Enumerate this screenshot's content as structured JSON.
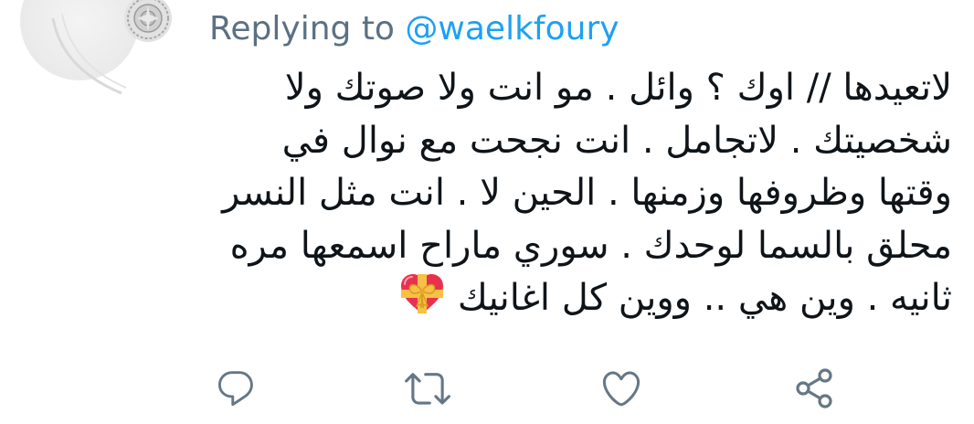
{
  "reply": {
    "prefix": "Replying to",
    "handle": "@waelkfoury"
  },
  "tweet": {
    "lines": [
      "لاتعيدها // اوك ؟ وائل . مو انت ولا صوتك ولا",
      "شخصيتك . لاتجامل . انت نجحت مع نوال في",
      "وقتها وظروفها وزمنها . الحين لا . انت مثل النسر",
      "محلق بالسما لوحدك . سوري ماراح اسمعها مره",
      "ثانيه . وين هي .. ووين كل اغانيك"
    ],
    "trailing_emoji": "heart-with-ribbon-icon"
  },
  "actions": {
    "reply_icon": "reply-icon",
    "retweet_icon": "retweet-icon",
    "like_icon": "heart-icon",
    "share_icon": "share-icon"
  },
  "colors": {
    "muted_text": "#5b7083",
    "link_blue": "#1da1f2",
    "body_text": "#0f1419",
    "icon_gray": "#657786"
  }
}
